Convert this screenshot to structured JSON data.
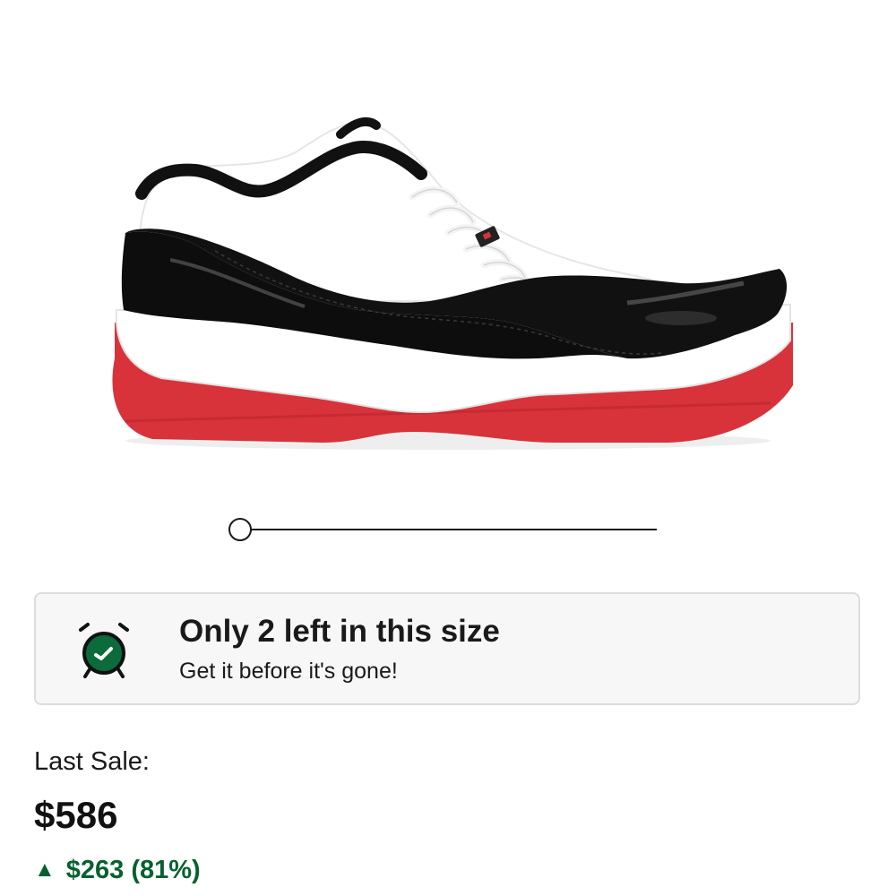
{
  "product": {
    "image_icon": "sneaker-image"
  },
  "carousel": {
    "position": 0
  },
  "stock_alert": {
    "icon": "alarm-clock-icon",
    "title": "Only 2 left in this size",
    "subtitle": "Get it before it's gone!",
    "accent_color": "#0b6b3a"
  },
  "last_sale": {
    "label": "Last Sale:",
    "price": "$586",
    "change_icon": "up-triangle-icon",
    "change_text": "$263 (81%)",
    "change_color": "#08602f"
  }
}
